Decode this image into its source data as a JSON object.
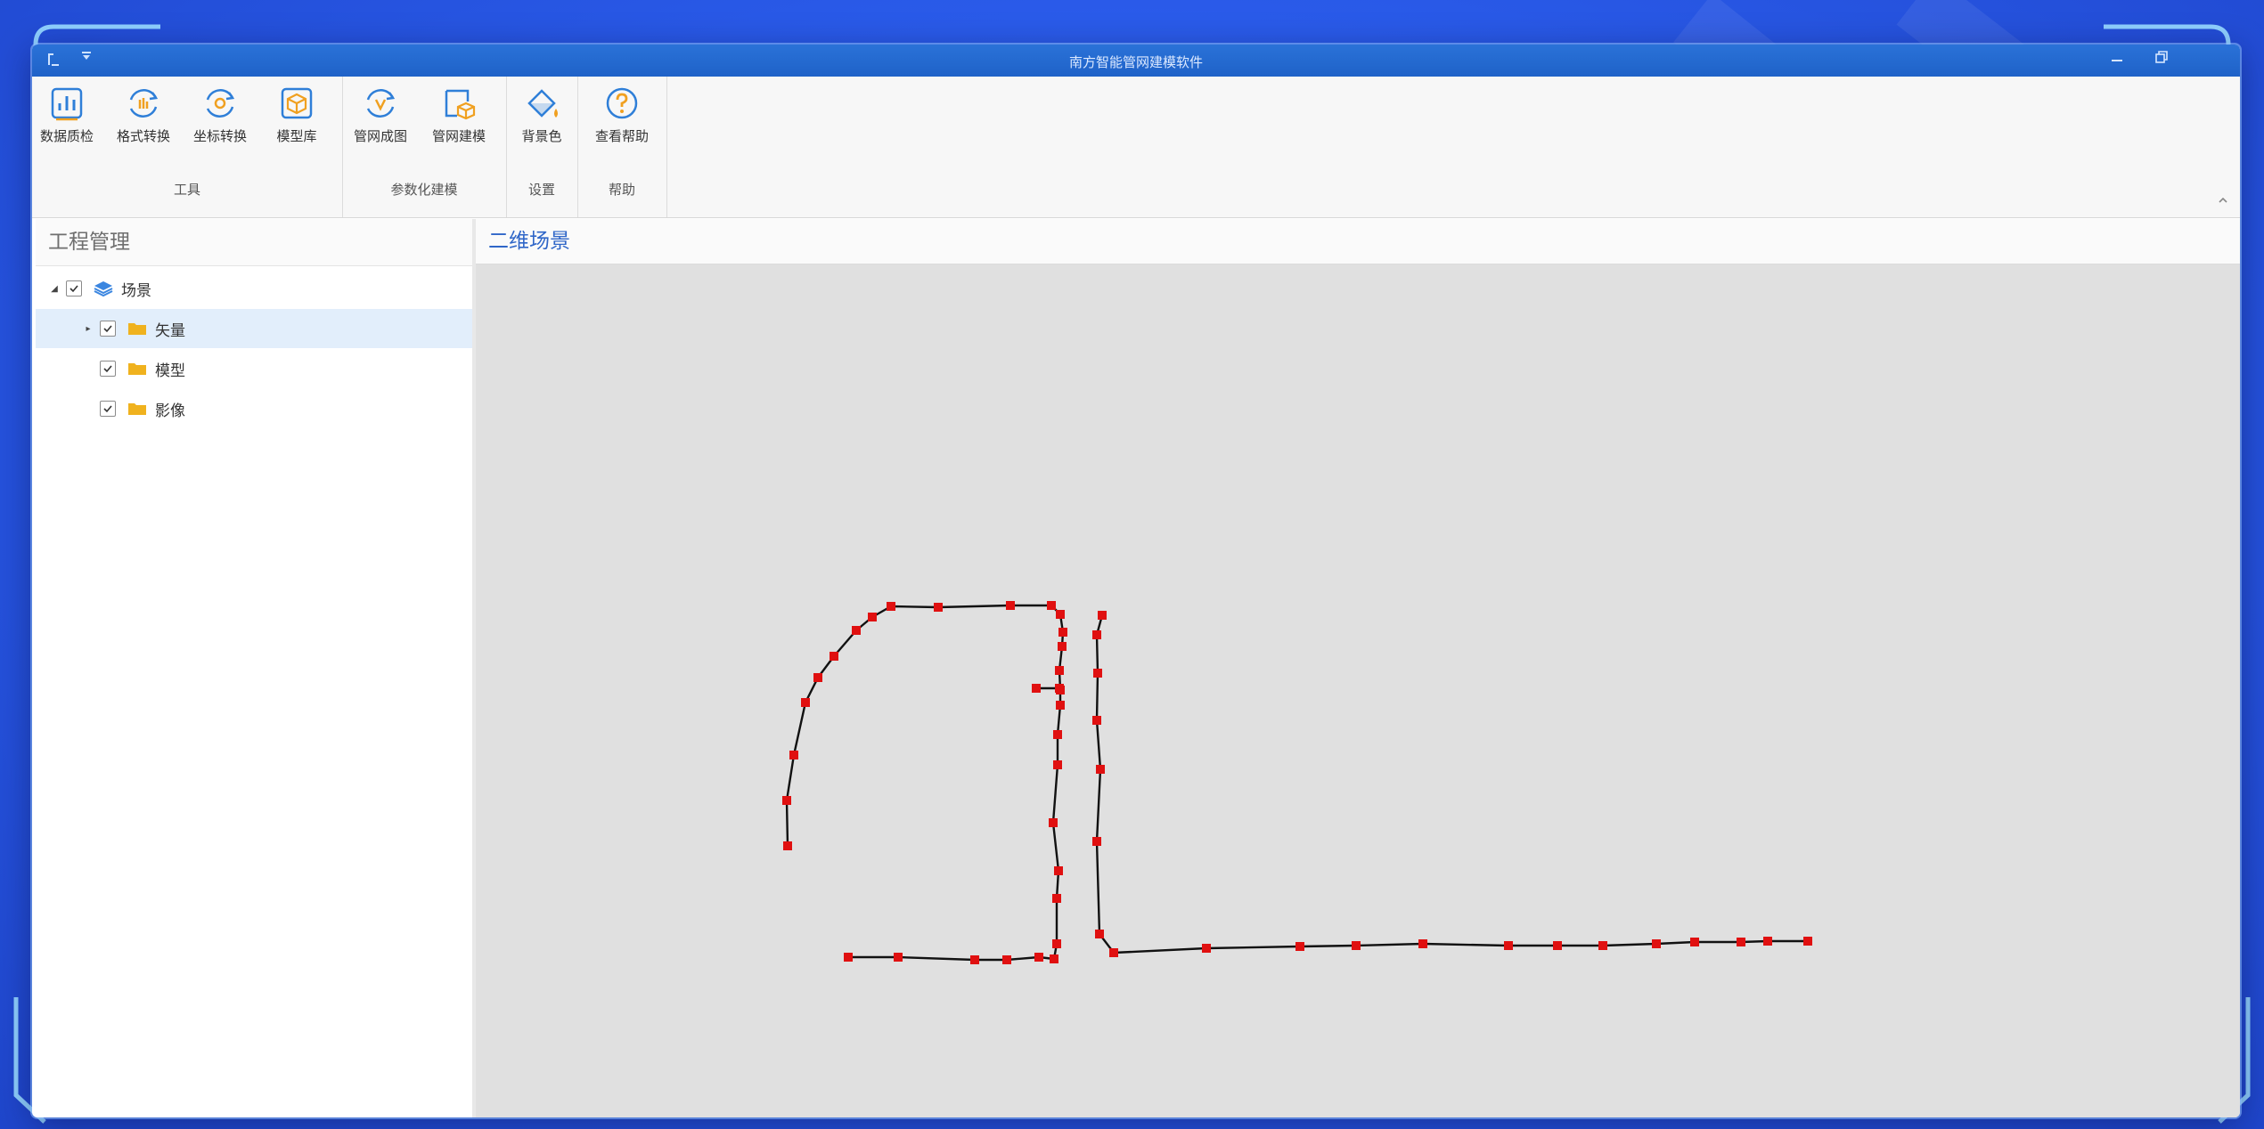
{
  "window": {
    "title": "南方智能管网建模软件"
  },
  "ribbon": {
    "groups": [
      {
        "label": "工具",
        "buttons": [
          {
            "label": "数据质检",
            "icon": "data-check-icon"
          },
          {
            "label": "格式转换",
            "icon": "format-convert-icon"
          },
          {
            "label": "坐标转换",
            "icon": "coordinate-convert-icon"
          },
          {
            "label": "模型库",
            "icon": "model-library-icon"
          }
        ]
      },
      {
        "label": "参数化建模",
        "buttons": [
          {
            "label": "管网成图",
            "icon": "pipe-mapping-icon"
          },
          {
            "label": "管网建模",
            "icon": "pipe-modeling-icon"
          }
        ]
      },
      {
        "label": "设置",
        "buttons": [
          {
            "label": "背景色",
            "icon": "paint-bucket-icon"
          }
        ]
      },
      {
        "label": "帮助",
        "buttons": [
          {
            "label": "查看帮助",
            "icon": "help-icon"
          }
        ]
      }
    ]
  },
  "project_panel": {
    "title": "工程管理",
    "tree": [
      {
        "label": "场景",
        "checked": true,
        "icon": "layers-icon"
      },
      {
        "label": "矢量",
        "checked": true,
        "icon": "folder-icon"
      },
      {
        "label": "模型",
        "checked": true,
        "icon": "folder-icon"
      },
      {
        "label": "影像",
        "checked": true,
        "icon": "folder-icon"
      }
    ]
  },
  "view": {
    "tab_title": "二维场景"
  },
  "colors": {
    "accent": "#1f62c8",
    "pipe_line": "#111111",
    "node": "#e01010",
    "canvas": "#e0e0e0",
    "icon_blue": "#2f7fd8",
    "folder": "#f0b21e"
  }
}
